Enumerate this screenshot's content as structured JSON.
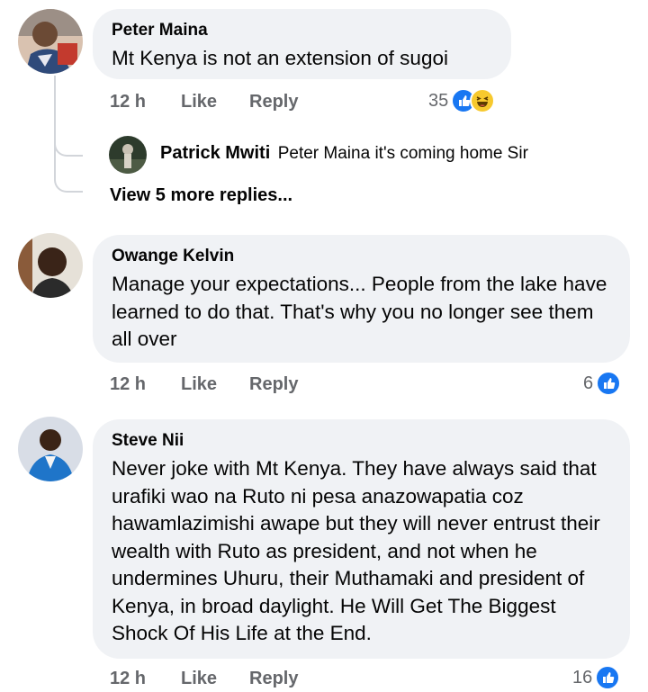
{
  "comments": [
    {
      "author": "Peter Maina",
      "text": "Mt Kenya is not an extension of sugoi",
      "time": "12 h",
      "like_label": "Like",
      "reply_label": "Reply",
      "reaction_count": "35",
      "reactions": [
        "like",
        "haha"
      ]
    },
    {
      "author": "Owange Kelvin",
      "text": "Manage your expectations... People from the lake have learned to do that. That's why you no longer see them all over",
      "time": "12 h",
      "like_label": "Like",
      "reply_label": "Reply",
      "reaction_count": "6",
      "reactions": [
        "like"
      ]
    },
    {
      "author": "Steve Nii",
      "text": "Never joke with Mt Kenya. They have always said that urafiki wao na Ruto ni pesa anazowapatia coz hawamlazimishi awape but they will never entrust their wealth with Ruto as president, and not when he undermines Uhuru, their Muthamaki and president of Kenya, in broad daylight.  He Will Get The Biggest Shock Of His Life at the End.",
      "time": "12 h",
      "like_label": "Like",
      "reply_label": "Reply",
      "reaction_count": "16",
      "reactions": [
        "like"
      ]
    }
  ],
  "reply": {
    "author": "Patrick Mwiti",
    "text": "Peter Maina it's coming home Sir"
  },
  "view_more_label": "View 5 more replies...",
  "colors": {
    "bubble": "#f0f2f5",
    "meta_text": "#65676b",
    "like_blue": "#1877f2",
    "haha_yellow": "#f7c92e",
    "thread_line": "#d2d5da"
  }
}
